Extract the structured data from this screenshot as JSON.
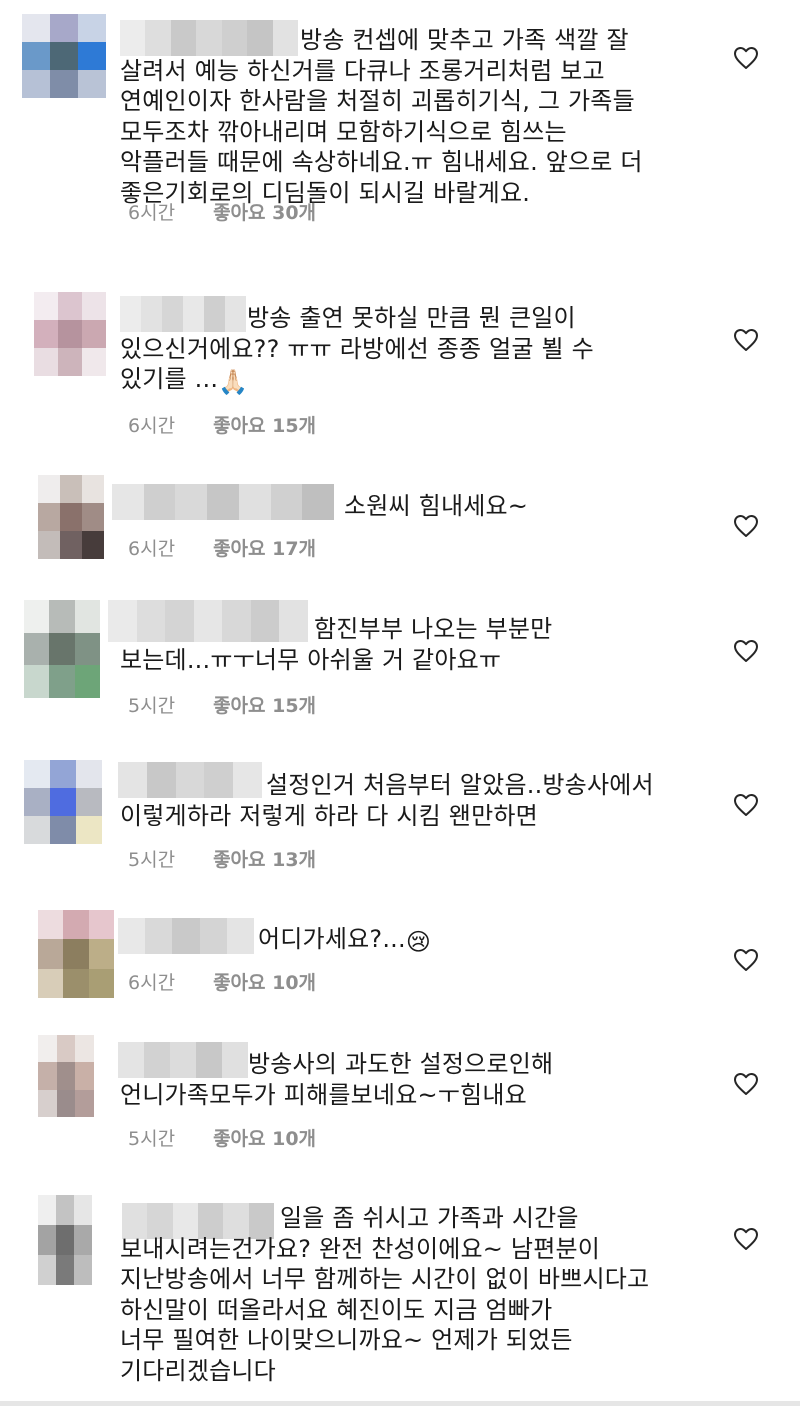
{
  "comments": [
    {
      "username": "",
      "lines": [
        "방송 컨셉에 맞추고 가족 색깔 잘",
        "살려서 예능 하신거를 다큐나 조롱거리처럼 보고",
        "연예인이자 한사람을 처절히 괴롭히기식, 그 가족들",
        "모두조차 깎아내리며 모함하기식으로 힘쓰는",
        "악플러들 때문에 속상하네요.ㅠ 힘내세요. 앞으로 더",
        "좋은기회로의 디딤돌이 되시길 바랄게요."
      ],
      "time": "6시간",
      "likes": "좋아요 30개",
      "avatar_colors": [
        "#e4e6ee",
        "#a7a8c9",
        "#c8d3e6",
        "#6a99c9",
        "#4d6876",
        "#2e7ad6",
        "#b6c1d6",
        "#7f8da8",
        "#b9c3d6"
      ],
      "username_colors": [
        "#ececec",
        "#dedede",
        "#c9c9c9",
        "#d8d8d8",
        "#cfcfcf",
        "#c5c5c5",
        "#e2e2e2"
      ]
    },
    {
      "username": "",
      "lines": [
        "방송 출연 못하실 만큼 뭔 큰일이",
        "있으신거에요?? ㅠㅠ 라방에선 종종 얼굴 뵐 수",
        "있기를 ..."
      ],
      "emoji": "🙏🏻",
      "time": "6시간",
      "likes": "좋아요 15개",
      "avatar_colors": [
        "#f3ecf0",
        "#dcc5cf",
        "#ede3e8",
        "#d3b0bc",
        "#b6939e",
        "#cba8b1",
        "#e9dde2",
        "#cdb4bb",
        "#f0e8eb"
      ],
      "username_colors": [
        "#ececec",
        "#e2e2e2",
        "#d6d6d6",
        "#e8e8e8",
        "#cfcfcf",
        "#e4e4e4"
      ]
    },
    {
      "username": "",
      "lines": [
        "소원씨 힘내세요~"
      ],
      "time": "6시간",
      "likes": "좋아요 17개",
      "avatar_colors": [
        "#efeded",
        "#c9bfb9",
        "#e8e3e0",
        "#b8a8a1",
        "#8a716b",
        "#a08c86",
        "#c3bcb9",
        "#706161",
        "#473c3b"
      ],
      "username_colors": [
        "#e6e6e6",
        "#cfcfcf",
        "#d9d9d9",
        "#c6c6c6",
        "#e0e0e0",
        "#d0d0d0",
        "#bfbfbf"
      ]
    },
    {
      "username": "",
      "lines": [
        "함진부부 나오는 부분만",
        "보는데...ㅠㅜ너무 아쉬울 거 같아요ㅠ"
      ],
      "time": "5시간",
      "likes": "좋아요 15개",
      "avatar_colors": [
        "#eef0ee",
        "#b7bbb8",
        "#e1e5e1",
        "#a9b1ad",
        "#68756b",
        "#7f9285",
        "#c8d7cd",
        "#7fa08a",
        "#6da578"
      ],
      "username_colors": [
        "#eaeaea",
        "#dddddd",
        "#d4d4d4",
        "#e6e6e6",
        "#d8d8d8",
        "#cccccc",
        "#e2e2e2"
      ]
    },
    {
      "username": "",
      "lines": [
        "설정인거 처음부터 알았음..방송사에서",
        "이렇게하라 저렇게 하라 다 시킴 왠만하면"
      ],
      "time": "5시간",
      "likes": "좋아요 13개",
      "avatar_colors": [
        "#e4e9f1",
        "#93a5d6",
        "#e3e5ec",
        "#a9b0c4",
        "#4f6ce0",
        "#b8bac0",
        "#d8dadc",
        "#7f8ca9",
        "#ece6c4"
      ],
      "username_colors": [
        "#e4e4e4",
        "#c8c8c8",
        "#d8d8d8",
        "#cfcfcf",
        "#e6e6e6"
      ]
    },
    {
      "username": "",
      "lines": [
        "어디가세요?..."
      ],
      "emoji": "😢",
      "time": "6시간",
      "likes": "좋아요 10개",
      "avatar_colors": [
        "#eddcdf",
        "#d3aab1",
        "#e6c6cd",
        "#b9a898",
        "#8c7e5f",
        "#bcae88",
        "#d8cdb8",
        "#9b8f6b",
        "#a99e74"
      ],
      "username_colors": [
        "#e8e8e8",
        "#d9d9d9",
        "#c9c9c9",
        "#d4d4d4",
        "#e4e4e4"
      ]
    },
    {
      "username": "",
      "lines": [
        "방송사의 과도한 설정으로인해",
        "언니가족모두가 피해를보네요~ㅜ힘내요"
      ],
      "time": "5시간",
      "likes": "좋아요 10개",
      "avatar_colors": [
        "#f1eeed",
        "#d9cac5",
        "#ece6e3",
        "#c5b0a9",
        "#a08f8c",
        "#c9b0a7",
        "#d7cfcd",
        "#9a8c8c",
        "#b39d9a"
      ],
      "username_colors": [
        "#e4e4e4",
        "#d2d2d2",
        "#dcdcdc",
        "#c8c8c8",
        "#e0e0e0"
      ]
    },
    {
      "username": "",
      "lines": [
        "일을 좀 쉬시고 가족과 시간을",
        "보내시려는건가요? 완전 찬성이에요~ 남편분이",
        "지난방송에서 너무 함께하는 시간이 없이 바쁘시다고",
        "하신말이 떠올라서요 혜진이도 지금 엄빠가",
        "너무 필여한 나이맞으니까요~ 언제가 되었든",
        "기다리겠습니다"
      ],
      "time": "",
      "likes": "",
      "avatar_colors": [
        "#efefef",
        "#c3c3c3",
        "#e6e6e6",
        "#a3a3a3",
        "#6e6e6e",
        "#a9a9a9",
        "#d0d0d0",
        "#7a7a7a",
        "#bdbdbd"
      ],
      "username_colors": [
        "#e0e0e0",
        "#d6d6d6",
        "#e8e8e8",
        "#cdcdcd",
        "#dedede",
        "#c9c9c9"
      ]
    }
  ],
  "icons": {
    "heart": "heart-outline-icon"
  },
  "colors": {
    "text": "#1a1a1a",
    "meta": "#8e8e8e",
    "heart_stroke": "#262626"
  }
}
